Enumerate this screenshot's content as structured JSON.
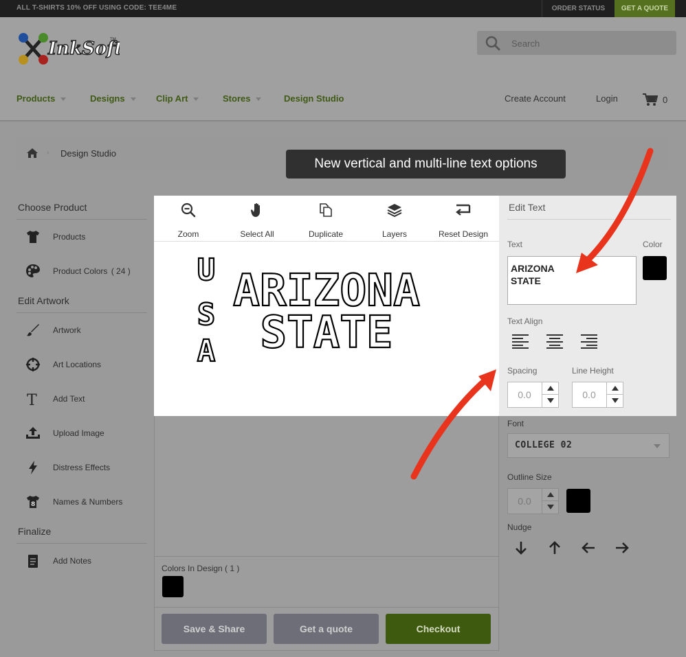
{
  "topbar": {
    "promo": "ALL T-SHIRTS 10% OFF USING CODE: TEE4ME",
    "order_status": "ORDER STATUS",
    "get_quote": "GET A QUOTE"
  },
  "header": {
    "search_placeholder": "Search",
    "nav": [
      "Products",
      "Designs",
      "Clip Art",
      "Stores",
      "Design Studio"
    ],
    "create_account": "Create Account",
    "login": "Login",
    "cart_count": "0"
  },
  "breadcrumb": {
    "current": "Design Studio"
  },
  "tooltip": "New vertical and multi-line text options",
  "sidebar": {
    "choose_product": "Choose Product",
    "products": "Products",
    "product_colors": "Product Colors",
    "product_colors_count": "( 24 )",
    "edit_artwork": "Edit Artwork",
    "artwork": "Artwork",
    "art_locations": "Art Locations",
    "add_text": "Add Text",
    "upload_image": "Upload Image",
    "distress_effects": "Distress Effects",
    "names_numbers": "Names & Numbers",
    "finalize": "Finalize",
    "add_notes": "Add Notes"
  },
  "toolbar": {
    "zoom": "Zoom",
    "select_all": "Select All",
    "duplicate": "Duplicate",
    "layers": "Layers",
    "reset_design": "Reset Design"
  },
  "canvas": {
    "vertical_text": [
      "U",
      "S",
      "A"
    ],
    "line1": "ARIZONA",
    "line2": "STATE"
  },
  "colors_in_design": "Colors In Design ( 1 )",
  "buttons": {
    "save_share": "Save & Share",
    "get_quote": "Get a quote",
    "checkout": "Checkout"
  },
  "edit_text": {
    "title": "Edit Text",
    "text_label": "Text",
    "color_label": "Color",
    "text_value_line1": "ARIZONA",
    "text_value_line2": "STATE",
    "text_align_label": "Text Align",
    "spacing_label": "Spacing",
    "line_height_label": "Line Height",
    "spacing_value": "0.0",
    "line_height_value": "0.0",
    "font_label": "Font",
    "font_value": "COLLEGE 02",
    "outline_size_label": "Outline Size",
    "outline_size_value": "0.0",
    "nudge_label": "Nudge",
    "text_color": "#000000"
  },
  "colors": {
    "accent_green": "#55701e",
    "nav_green": "#3f5a14",
    "annotation_arrow": "#e8341c"
  }
}
